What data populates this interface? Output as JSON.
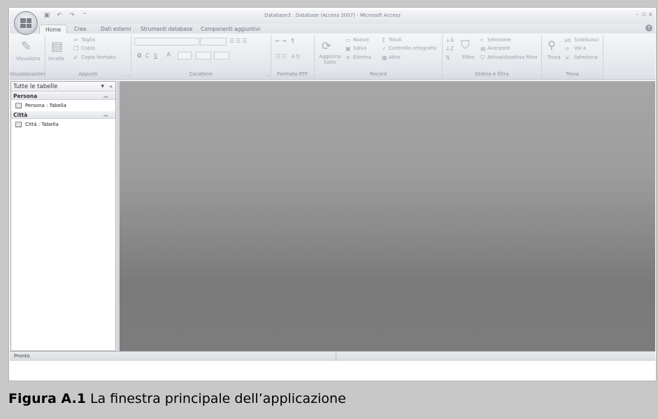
{
  "window": {
    "title": "Database3 : Database (Access 2007) - Microsoft Access",
    "controls": [
      "–",
      "▫",
      "x"
    ]
  },
  "quick_access": [
    "▣",
    "↶",
    "↷",
    "⁼"
  ],
  "tabs": [
    {
      "label": "Home",
      "active": true
    },
    {
      "label": "Crea"
    },
    {
      "label": "Dati esterni"
    },
    {
      "label": "Strumenti database"
    },
    {
      "label": "Componenti aggiuntivi"
    }
  ],
  "help_icon": "?",
  "ribbon": {
    "visualizzazioni": {
      "label": "Visualizzazioni",
      "button": "Visualizza"
    },
    "appunti": {
      "label": "Appunti",
      "incolla": "Incolla",
      "taglia": "Taglia",
      "copia": "Copia",
      "copia_formato": "Copia formato"
    },
    "carattere": {
      "label": "Carattere",
      "bold": "G",
      "italic": "C",
      "underline": "S",
      "font_color": "A"
    },
    "formato_rtf": {
      "label": "Formato RTF"
    },
    "record": {
      "label": "Record",
      "aggiorna": "Aggiorna tutto",
      "nuovo": "Nuovo",
      "salva": "Salva",
      "elimina": "Elimina",
      "totali": "Totali",
      "controllo": "Controllo ortografia",
      "altro": "Altro"
    },
    "ordina": {
      "label": "Ordina e filtra",
      "filtro": "Filtro",
      "selezione": "Selezione",
      "avanzate": "Avanzate",
      "attiva": "Attiva/disattiva filtro"
    },
    "trova": {
      "label": "Trova",
      "trova": "Trova",
      "sostituisci": "Sostituisci",
      "vai": "Vai a",
      "seleziona": "Seleziona"
    }
  },
  "nav": {
    "header": "Tutte le tabelle",
    "groups": [
      {
        "name": "Persona",
        "items": [
          "Persona : Tabella"
        ]
      },
      {
        "name": "Città",
        "items": [
          "Città : Tabella"
        ]
      }
    ]
  },
  "status": "Pronto",
  "caption": {
    "prefix": "Figura A.1",
    "text": " La finestra principale dell’applicazione"
  }
}
